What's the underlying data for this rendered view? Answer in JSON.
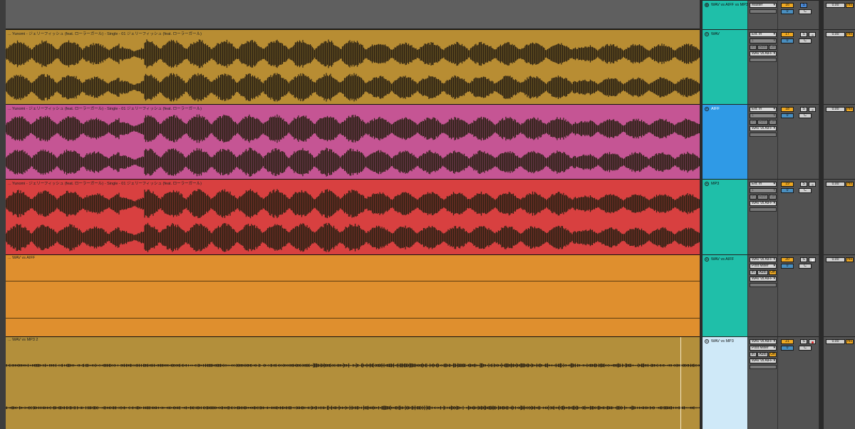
{
  "colors": {
    "wav_clip": "#b88d33",
    "aiff_clip": "#c55594",
    "mp3_clip": "#d84040",
    "wav_vs_aiff_clip": "#df8f2e",
    "wav_vs_mp3_clip": "#b38f3b",
    "wave_dark": "#2a2114",
    "name_teal": "#1fbfa9",
    "name_blue": "#2f9ae6",
    "name_light": "#cfe9f8"
  },
  "master": {
    "name": "WAV vs AIFF vs MP3",
    "output": "Master",
    "number": "16",
    "solo": "S",
    "volume": "0",
    "pan": "C",
    "delay": "0.00",
    "delay_unit": "ms"
  },
  "tracks": [
    {
      "clip_title": "... Yunomi - ジェリーフィッシュ (feat. ローラーガール) - Single - 01 ジェリーフィッシュ (feat. ローラーガール)",
      "name": "WAV",
      "input": "Ext. In",
      "channel": "1",
      "monitor": [
        "In",
        "Auto",
        "Off"
      ],
      "output": "WAV vs AIFF",
      "number": "17",
      "solo": "S",
      "volume": "0",
      "pan": "C",
      "delay": "0.00",
      "delay_unit": "ms",
      "arm": "off"
    },
    {
      "clip_title": "... Yunomi - ジェリーフィッシュ (feat. ローラーガール) - Single - 01 ジェリーフィッシュ (feat. ローラーガール)",
      "name": "AIFF",
      "input": "Ext. In",
      "channel": "1",
      "monitor": [
        "In",
        "Auto",
        "Off"
      ],
      "output": "WAV vs AIFF",
      "number": "18",
      "solo": "S",
      "volume": "0",
      "pan": "C",
      "delay": "0.00",
      "delay_unit": "ms",
      "arm": "off"
    },
    {
      "clip_title": "... Yunomi - ジェリーフィッシュ (feat. ローラーガール) - Single - 01 ジェリーフィッシュ (feat. ローラーガール)",
      "name": "MP3",
      "input": "Ext. In",
      "channel": "1",
      "monitor": [
        "In",
        "Auto",
        "Off"
      ],
      "output": "WAV vs AIFF",
      "number": "19",
      "solo": "S",
      "volume": "0",
      "pan": "C",
      "delay": "0.00",
      "delay_unit": "ms",
      "arm": "off"
    },
    {
      "clip_title": "... WAV vs AIFF",
      "name": "WAV vs AIFF",
      "input": "WAV vs AIFF",
      "channel": "Post Mixer",
      "monitor": [
        "In",
        "Auto",
        "Off"
      ],
      "output": "WAV vs AIFF",
      "number": "20",
      "solo": "S",
      "volume": "0",
      "pan": "C",
      "delay": "0.00",
      "delay_unit": "ms",
      "arm": "white"
    },
    {
      "clip_title": "... WAV vs MP3 2",
      "name": "WAV vs MP3",
      "input": "WAV vs AIFF",
      "channel": "Post Mixer",
      "monitor": [
        "In",
        "Auto",
        "Off"
      ],
      "output": "WAV vs AIFF",
      "number": "21",
      "solo": "S",
      "volume": "0",
      "pan": "C",
      "delay": "0.00",
      "delay_unit": "ms",
      "arm": "red"
    }
  ]
}
